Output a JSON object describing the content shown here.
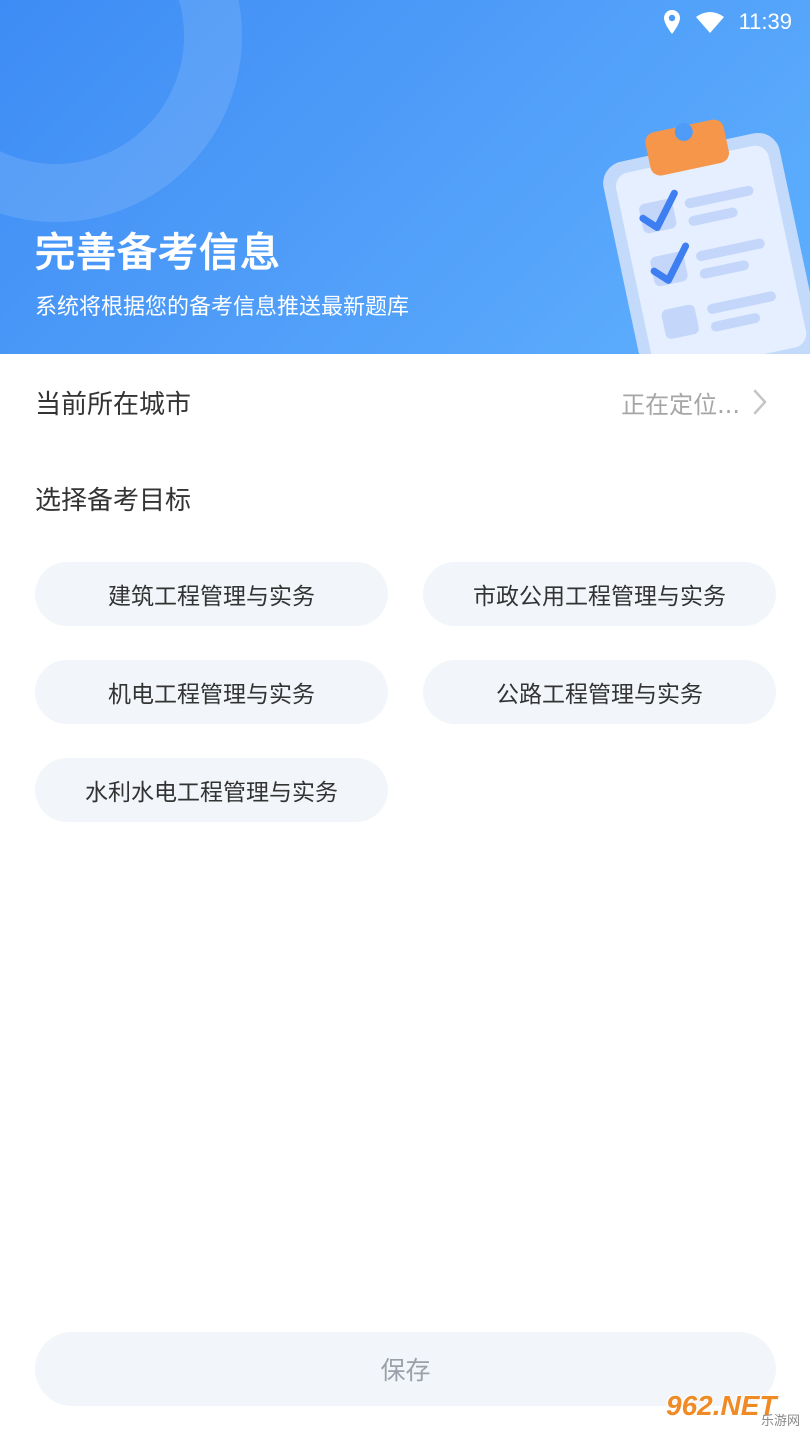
{
  "status_bar": {
    "time": "11:39",
    "icons": [
      "location-pin-icon",
      "wifi-icon"
    ]
  },
  "header": {
    "title": "完善备考信息",
    "subtitle": "系统将根据您的备考信息推送最新题库",
    "illustration": "clipboard-checklist-icon"
  },
  "city": {
    "label": "当前所在城市",
    "value": "正在定位...",
    "icon": "chevron-right-icon"
  },
  "goal": {
    "title": "选择备考目标",
    "options": [
      "建筑工程管理与实务",
      "市政公用工程管理与实务",
      "机电工程管理与实务",
      "公路工程管理与实务",
      "水利水电工程管理与实务"
    ]
  },
  "save_button": {
    "label": "保存"
  },
  "watermark": {
    "main": "962.NET",
    "sub": "乐游网"
  },
  "colors": {
    "header_gradient_start": "#3d8cf5",
    "header_gradient_end": "#5fb0ff",
    "chip_background": "#f2f5fa",
    "text_primary": "#333333",
    "text_secondary": "#a6a6a6",
    "button_text_disabled": "#9aa1ab",
    "clipboard_accent": "#f5964a"
  }
}
